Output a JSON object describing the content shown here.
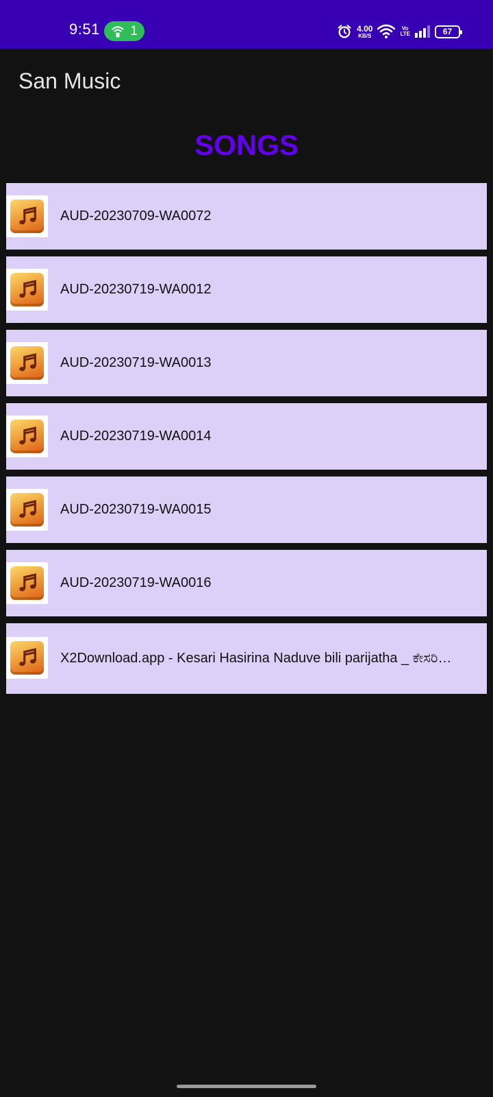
{
  "status_bar": {
    "time": "9:51",
    "hotspot_count": "1",
    "net_speed_value": "4.00",
    "net_speed_unit": "KB/S",
    "volte_top": "Vo",
    "volte_bottom": "LTE",
    "battery_level": "67",
    "background_color": "#3700b3",
    "icons": [
      "hotspot-icon",
      "alarm-icon",
      "wifi-icon",
      "signal-icon",
      "battery-icon"
    ]
  },
  "app_bar": {
    "title": "San Music"
  },
  "heading": {
    "label": "SONGS",
    "color": "#6200ee"
  },
  "songs": [
    {
      "title": "AUD-20230709-WA0072",
      "icon": "music-note-icon"
    },
    {
      "title": "AUD-20230719-WA0012",
      "icon": "music-note-icon"
    },
    {
      "title": "AUD-20230719-WA0013",
      "icon": "music-note-icon"
    },
    {
      "title": "AUD-20230719-WA0014",
      "icon": "music-note-icon"
    },
    {
      "title": "AUD-20230719-WA0015",
      "icon": "music-note-icon"
    },
    {
      "title": "AUD-20230719-WA0016",
      "icon": "music-note-icon"
    },
    {
      "title": "X2Download.app - Kesari Hasirina Naduve bili parijatha _ ಕೇಸರಿ…",
      "icon": "music-note-icon"
    }
  ],
  "colors": {
    "background": "#121212",
    "row_background": "#ddd0f8"
  }
}
